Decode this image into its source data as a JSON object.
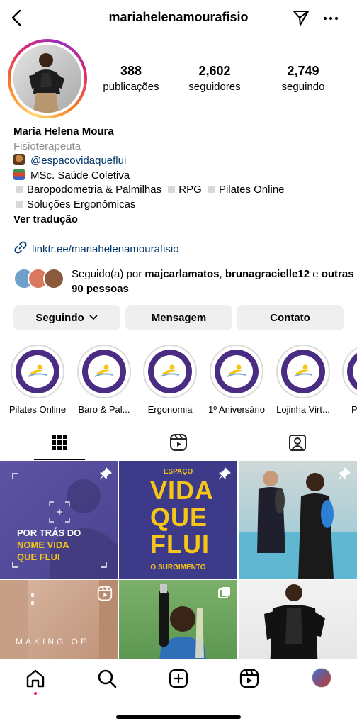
{
  "header": {
    "username": "mariahelenamourafisio",
    "back_icon": "chevron-left-icon",
    "send_icon": "paper-plane-icon",
    "more_icon": "more-horizontal-icon"
  },
  "profile": {
    "stats": [
      {
        "value": "388",
        "label": "publicações"
      },
      {
        "value": "2,602",
        "label": "seguidores"
      },
      {
        "value": "2,749",
        "label": "seguindo"
      }
    ],
    "name": "Maria Helena Moura",
    "category": "Fisioterapeuta",
    "bio": {
      "mention": "@espacovidaqueflui",
      "line2": "MSc. Saúde Coletiva",
      "tags_line1": [
        "Baropodometria & Palmilhas",
        "RPG",
        "Pilates Online"
      ],
      "tags_line2": [
        "Soluções Ergonômicas"
      ],
      "see_translation": "Ver tradução"
    },
    "link": "linktr.ee/mariahelenamourafisio",
    "followed_by": {
      "prefix": "Seguido(a) por",
      "user1": "majcarlamatos",
      "sep": ",",
      "user2": "brunagracielle12",
      "and": "e",
      "others": "outras 90 pessoas"
    }
  },
  "buttons": {
    "following": "Seguindo",
    "message": "Mensagem",
    "contact": "Contato"
  },
  "highlights": [
    {
      "label": "Pilates Online"
    },
    {
      "label": "Baro & Pal..."
    },
    {
      "label": "Ergonomia"
    },
    {
      "label": "1º Aniversário"
    },
    {
      "label": "Lojinha Virt..."
    },
    {
      "label": "P"
    }
  ],
  "tabs": {
    "grid_icon": "grid-icon",
    "reels_icon": "reels-icon",
    "tagged_icon": "tagged-person-icon"
  },
  "posts": {
    "post1": {
      "line1": "POR TRÁS DO",
      "line2": "NOME VIDA",
      "line3": "QUE FLUI"
    },
    "post2": {
      "top": "ESPAÇO",
      "w1": "VIDA",
      "w2": "QUE",
      "w3": "FLUI",
      "bottom": "O SURGIMENTO"
    },
    "post4": {
      "text": "MAKING OF"
    }
  },
  "colors": {
    "link": "#00376b",
    "muted": "#8e8e8e",
    "button_bg": "#efefef",
    "brand_purple": "#4a2d82",
    "brand_yellow": "#f5c518",
    "notification_dot": "#ed1c3c"
  },
  "bottom_nav": [
    "home-icon",
    "search-icon",
    "create-post-icon",
    "reels-icon",
    "profile-avatar"
  ]
}
